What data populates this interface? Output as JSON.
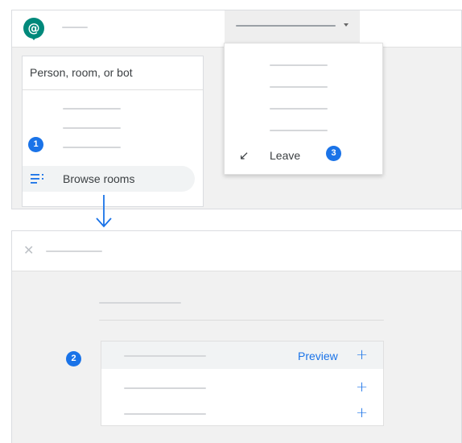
{
  "top_panel": {
    "logo_glyph": "@",
    "search_placeholder": "Person, room, or bot",
    "browse_rooms_label": "Browse rooms",
    "menu": {
      "leave_label": "Leave",
      "leave_icon": "↙"
    }
  },
  "bottom_panel": {
    "close_icon": "✕",
    "rows": [
      {
        "action_label": "Preview",
        "add_icon": "+"
      },
      {
        "add_icon": "+"
      },
      {
        "add_icon": "+"
      }
    ]
  },
  "steps": [
    "1",
    "2",
    "3"
  ],
  "icons": {
    "logo": "chat-logo-icon",
    "browse": "browse-rooms-icon",
    "leave": "leave-arrow-icon",
    "close": "close-icon",
    "add": "plus-icon",
    "flow": "down-arrow-icon",
    "dropdown": "caret-down-icon"
  },
  "colors": {
    "accent": "#1a73e8",
    "logo": "#00897b",
    "background": "#f1f1f1"
  }
}
